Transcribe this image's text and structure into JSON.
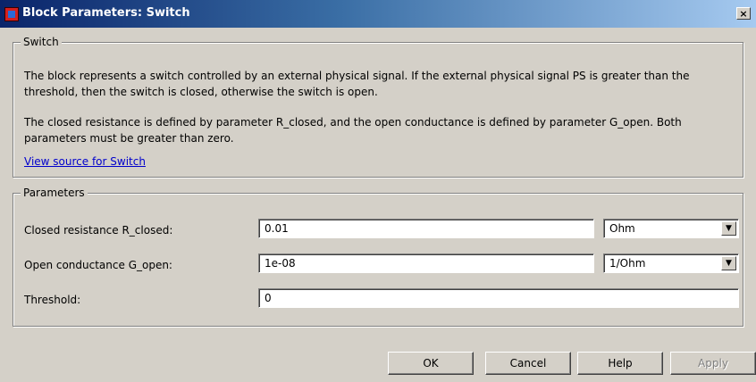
{
  "window": {
    "title": "Block Parameters: Switch",
    "close_label": "×"
  },
  "description_group": {
    "legend": "Switch",
    "paragraph1": "The block represents a switch controlled by an external physical signal. If the external physical signal PS is greater than the threshold, then the switch is closed, otherwise the switch is open.",
    "paragraph2": "The closed resistance is defined by parameter R_closed, and the open conductance is defined by parameter G_open. Both parameters must be greater than zero.",
    "source_link": "View source for Switch"
  },
  "parameters_group": {
    "legend": "Parameters",
    "rows": [
      {
        "label": "Closed resistance R_closed:",
        "value": "0.01",
        "unit": "Ohm"
      },
      {
        "label": "Open conductance G_open:",
        "value": "1e-08",
        "unit": "1/Ohm"
      },
      {
        "label": "Threshold:",
        "value": "0"
      }
    ]
  },
  "buttons": {
    "ok": "OK",
    "cancel": "Cancel",
    "help": "Help",
    "apply": "Apply"
  },
  "icons": {
    "title_icon": "simulink-block-icon",
    "close": "close-icon",
    "dropdown": "chevron-down-icon"
  }
}
